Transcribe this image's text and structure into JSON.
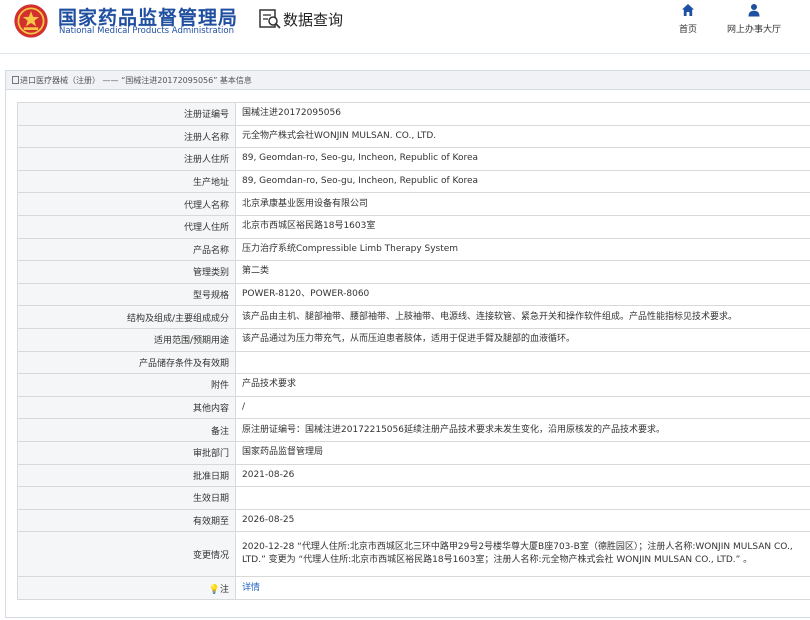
{
  "header": {
    "site_name_cn": "国家药品监督管理局",
    "site_name_en": "National Medical Products Administration",
    "query_title": "数据查询",
    "nav": [
      {
        "label": "首页",
        "icon": "home-icon"
      },
      {
        "label": "网上办事大厅",
        "icon": "user-icon"
      }
    ],
    "brand_color": "#1f4fa0",
    "emblem_color": "#d32f2f"
  },
  "breadcrumb": {
    "root": "进口医疗器械（注册）",
    "separator": "——",
    "current": "“国械注进20172095056” 基本信息"
  },
  "fields": [
    {
      "label": "注册证编号",
      "value": "国械注进20172095056"
    },
    {
      "label": "注册人名称",
      "value": "元全物产株式会社WONJIN MULSAN. CO., LTD."
    },
    {
      "label": "注册人住所",
      "value": "89, Geomdan-ro, Seo-gu, Incheon, Republic of Korea"
    },
    {
      "label": "生产地址",
      "value": "89, Geomdan-ro, Seo-gu, Incheon, Republic of Korea"
    },
    {
      "label": "代理人名称",
      "value": "北京承康基业医用设备有限公司"
    },
    {
      "label": "代理人住所",
      "value": "北京市西城区裕民路18号1603室"
    },
    {
      "label": "产品名称",
      "value": "压力治疗系统Compressible Limb Therapy System"
    },
    {
      "label": "管理类别",
      "value": "第二类"
    },
    {
      "label": "型号规格",
      "value": "POWER-8120、POWER-8060"
    },
    {
      "label": "结构及组成/主要组成成分",
      "value": "该产品由主机、腿部袖带、腰部袖带、上肢袖带、电源线、连接软管、紧急开关和操作软件组成。产品性能指标见技术要求。"
    },
    {
      "label": "适用范围/预期用途",
      "value": "该产品通过为压力带充气，从而压迫患者肢体，适用于促进手臂及腿部的血液循环。"
    },
    {
      "label": "产品储存条件及有效期",
      "value": ""
    },
    {
      "label": "附件",
      "value": "产品技术要求"
    },
    {
      "label": "其他内容",
      "value": "/"
    },
    {
      "label": "备注",
      "value": "原注册证编号：国械注进20172215056延续注册产品技术要求未发生变化，沿用原核发的产品技术要求。"
    },
    {
      "label": "审批部门",
      "value": "国家药品监督管理局"
    },
    {
      "label": "批准日期",
      "value": "2021-08-26"
    },
    {
      "label": "生效日期",
      "value": ""
    },
    {
      "label": "有效期至",
      "value": "2026-08-25"
    },
    {
      "label": "变更情况",
      "value": "2020-12-28 “代理人住所:北京市西城区北三环中路甲29号2号楼华尊大厦B座703-B室（德胜园区）；注册人名称:WONJIN MULSAN CO., LTD.” 变更为 “代理人住所:北京市西城区裕民路18号1603室；注册人名称:元全物产株式会社 WONJIN MULSAN CO., LTD.” 。"
    }
  ],
  "note_row": {
    "label": "注",
    "link_text": "详情"
  }
}
